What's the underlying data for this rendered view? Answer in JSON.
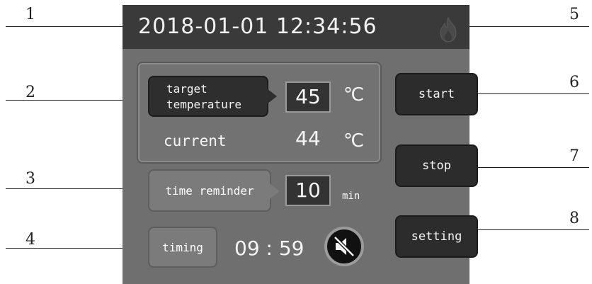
{
  "callouts": [
    "1",
    "2",
    "3",
    "4",
    "5",
    "6",
    "7",
    "8"
  ],
  "header": {
    "datetime": "2018-01-01 12:34:56",
    "flame_icon": "flame-icon"
  },
  "temperature": {
    "target_label_line1": "target",
    "target_label_line2": "temperature",
    "target_value": "45",
    "target_unit": "℃",
    "current_label": "current",
    "current_value": "44",
    "current_unit": "℃"
  },
  "reminder": {
    "label": "time reminder",
    "value": "10",
    "unit": "min"
  },
  "timer": {
    "label": "timing",
    "countdown": "09 : 59",
    "mute_icon": "mute-icon"
  },
  "controls": {
    "start": "start",
    "stop": "stop",
    "setting": "setting"
  },
  "colors": {
    "panel": "#6f6f6f",
    "header": "#3a3a3a",
    "button": "#2c2c2c"
  }
}
